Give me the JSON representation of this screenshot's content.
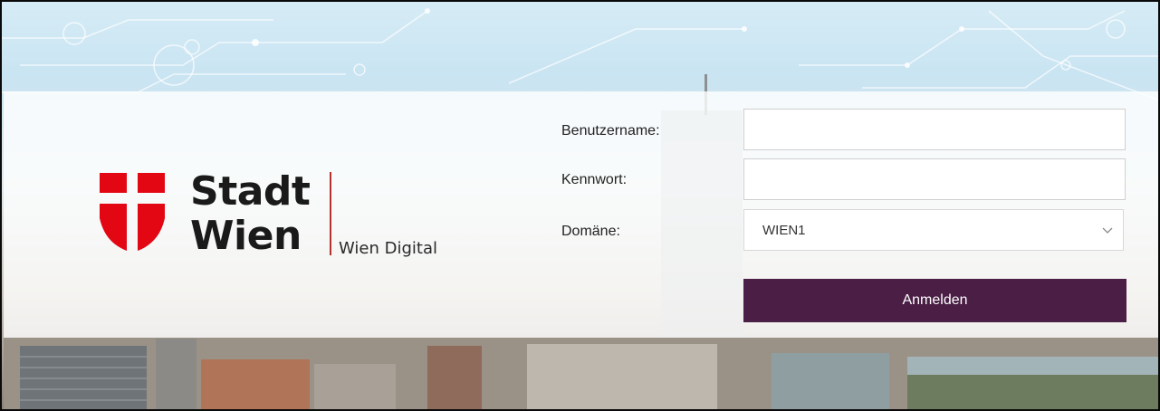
{
  "brand": {
    "line1": "Stadt",
    "line2": "Wien",
    "sub": "Wien Digital",
    "shield_color": "#e30613"
  },
  "form": {
    "username_label": "Benutzername:",
    "username_value": "",
    "password_label": "Kennwort:",
    "password_value": "",
    "domain_label": "Domäne:",
    "domain_value": "WIEN1",
    "submit_label": "Anmelden",
    "accent_color": "#4a1e45"
  },
  "icons": {
    "select_chevron": "chevron-down-icon"
  }
}
